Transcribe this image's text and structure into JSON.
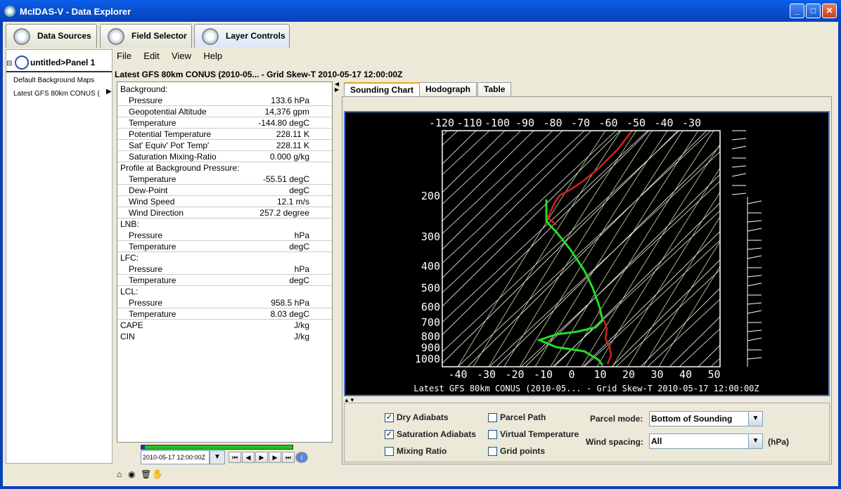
{
  "window": {
    "title": "McIDAS-V - Data Explorer"
  },
  "top_tabs": [
    {
      "label": "Data Sources"
    },
    {
      "label": "Field Selector"
    },
    {
      "label": "Layer Controls"
    }
  ],
  "tree": {
    "root": "untitled>Panel 1",
    "items": [
      "Default Background Maps",
      "Latest GFS 80km CONUS ("
    ]
  },
  "menu": [
    "File",
    "Edit",
    "View",
    "Help"
  ],
  "display_title": "Latest GFS 80km CONUS (2010-05... - Grid Skew-T 2010-05-17 12:00:00Z",
  "readout": [
    {
      "label": "Background:",
      "value": "",
      "sub": false
    },
    {
      "label": "Pressure",
      "value": "133.6 hPa",
      "sub": true
    },
    {
      "label": "Geopotential Altitude",
      "value": "14,376 gpm",
      "sub": true
    },
    {
      "label": "Temperature",
      "value": "-144.80 degC",
      "sub": true
    },
    {
      "label": "Potential Temperature",
      "value": "228.11 K",
      "sub": true
    },
    {
      "label": "Sat' Equiv' Pot' Temp'",
      "value": "228.11 K",
      "sub": true
    },
    {
      "label": "Saturation Mixing-Ratio",
      "value": "0.000 g/kg",
      "sub": true
    },
    {
      "label": "Profile at Background Pressure:",
      "value": "",
      "sub": false
    },
    {
      "label": "Temperature",
      "value": "-55.51 degC",
      "sub": true
    },
    {
      "label": "Dew-Point",
      "value": "degC",
      "sub": true
    },
    {
      "label": "Wind Speed",
      "value": "12.1 m/s",
      "sub": true
    },
    {
      "label": "Wind Direction",
      "value": "257.2 degree",
      "sub": true
    },
    {
      "label": "LNB:",
      "value": "",
      "sub": false
    },
    {
      "label": "Pressure",
      "value": "hPa",
      "sub": true
    },
    {
      "label": "Temperature",
      "value": "degC",
      "sub": true
    },
    {
      "label": "LFC:",
      "value": "",
      "sub": false
    },
    {
      "label": "Pressure",
      "value": "hPa",
      "sub": true
    },
    {
      "label": "Temperature",
      "value": "degC",
      "sub": true
    },
    {
      "label": "LCL:",
      "value": "",
      "sub": false
    },
    {
      "label": "Pressure",
      "value": "958.5 hPa",
      "sub": true
    },
    {
      "label": "Temperature",
      "value": "8.03 degC",
      "sub": true
    },
    {
      "label": "CAPE",
      "value": "J/kg",
      "sub": false
    },
    {
      "label": "CIN",
      "value": "J/kg",
      "sub": false
    }
  ],
  "time": {
    "current": "2010-05-17 12:00:00Z"
  },
  "inner_tabs": [
    {
      "label": "Sounding Chart"
    },
    {
      "label": "Hodograph"
    },
    {
      "label": "Table"
    }
  ],
  "chart": {
    "top_ticks": [
      "-120",
      "-110",
      "-100",
      "-90",
      "-80",
      "-70",
      "-60",
      "-50",
      "-40",
      "-30"
    ],
    "bottom_ticks": [
      "-40",
      "-30",
      "-20",
      "-10",
      "0",
      "10",
      "20",
      "30",
      "40",
      "50"
    ],
    "pressure_ticks": [
      "200",
      "300",
      "400",
      "500",
      "600",
      "700",
      "800",
      "900",
      "1000"
    ],
    "caption": "Latest GFS 80km CONUS (2010-05... - Grid Skew-T 2010-05-17 12:00:00Z",
    "colors": {
      "temperature": "#d42020",
      "dewpoint": "#22dd22",
      "dry_adiabat": "#ffffff",
      "sat_adiabat": "#c8e8a0",
      "mixing": "#8fd88f"
    }
  },
  "options": {
    "dry_adiabats": {
      "label": "Dry Adiabats",
      "checked": true
    },
    "saturation_adiabats": {
      "label": "Saturation Adiabats",
      "checked": true
    },
    "mixing_ratio": {
      "label": "Mixing Ratio",
      "checked": false
    },
    "parcel_path": {
      "label": "Parcel Path",
      "checked": false
    },
    "virtual_temperature": {
      "label": "Virtual Temperature",
      "checked": false
    },
    "grid_points": {
      "label": "Grid points",
      "checked": false
    },
    "parcel_mode_label": "Parcel mode:",
    "parcel_mode_value": "Bottom of Sounding",
    "wind_spacing_label": "Wind spacing:",
    "wind_spacing_value": "All",
    "wind_spacing_unit": "(hPa)"
  }
}
